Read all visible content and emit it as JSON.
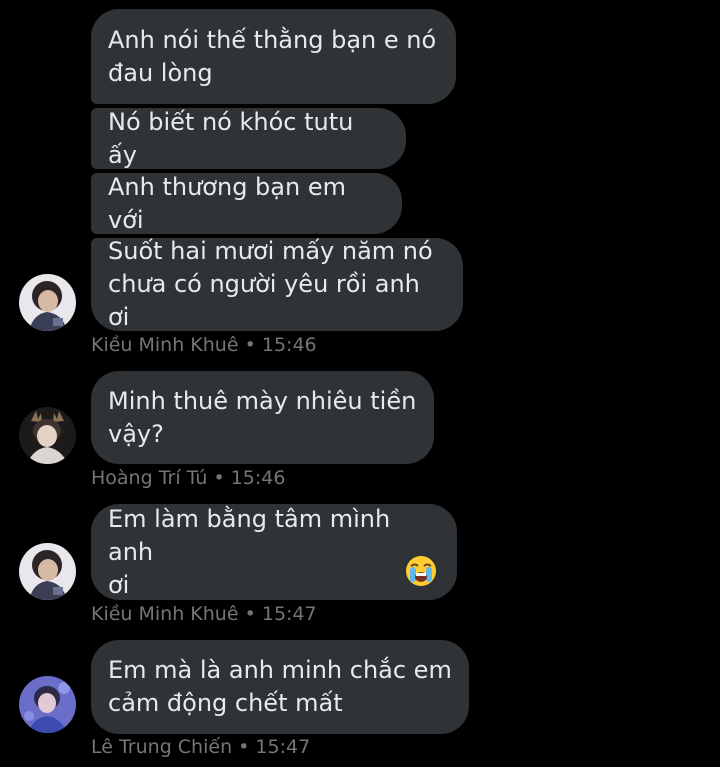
{
  "messages": [
    {
      "bubbles": [
        "Anh nói thế thằng bạn e nó\nđau lòng",
        "Nó biết nó khóc tutu ấy",
        "Anh thương bạn em với",
        "Suốt hai mươi mấy năm nó\nchưa có người yêu rồi anh ơi"
      ],
      "sender": "Kiều Minh Khuê",
      "separator": "•",
      "time": "15:46",
      "avatar_icon": "profile-photo-dark-hair"
    },
    {
      "bubbles": [
        "Minh thuê mày nhiêu tiền\nvậy?"
      ],
      "sender": "Hoàng Trí Tú",
      "separator": "•",
      "time": "15:46",
      "avatar_icon": "profile-photo-antlers"
    },
    {
      "bubbles": [
        "Em làm bằng tâm mình anh\nơi"
      ],
      "emoji": "loudly-crying-face-emoji",
      "sender": "Kiều Minh Khuê",
      "separator": "•",
      "time": "15:47",
      "avatar_icon": "profile-photo-dark-hair"
    },
    {
      "bubbles": [
        "Em mà là anh minh chắc em\ncảm động chết mất"
      ],
      "sender": "Lê Trung Chiến",
      "separator": "•",
      "time": "15:47",
      "avatar_icon": "profile-photo-purple"
    }
  ],
  "colors": {
    "background": "#000000",
    "bubble": "#2f3336",
    "bubble_text": "#e7e9ea",
    "meta_text": "#71767b"
  }
}
